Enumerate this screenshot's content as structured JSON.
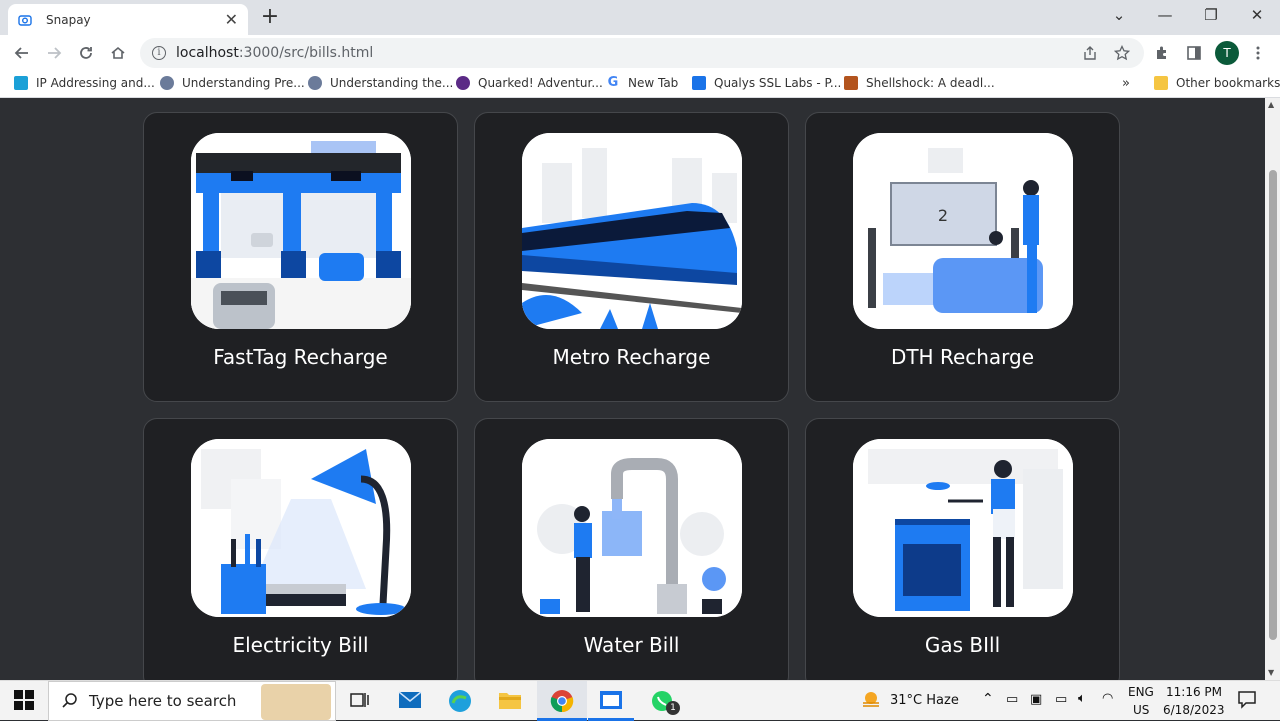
{
  "browser": {
    "tab_title": "Snapay",
    "url_host": "localhost",
    "url_path": ":3000/src/bills.html",
    "profile_initial": "T"
  },
  "bookmarks": [
    {
      "label": "IP Addressing and...",
      "icon": "cisco-icon",
      "color": "#1ba0d7"
    },
    {
      "label": "Understanding Pre...",
      "icon": "gear-favicon-icon",
      "color": "#6b7b9a"
    },
    {
      "label": "Understanding the...",
      "icon": "gear-favicon-icon",
      "color": "#6b7b9a"
    },
    {
      "label": "Quarked! Adventur...",
      "icon": "quarked-icon",
      "color": "#5b2a86"
    },
    {
      "label": "New Tab",
      "icon": "google-icon",
      "color": "#4285f4"
    },
    {
      "label": "Qualys SSL Labs - P...",
      "icon": "qualys-icon",
      "color": "#1a73e8"
    },
    {
      "label": "Shellshock: A deadl...",
      "icon": "shellshock-icon",
      "color": "#b3541e"
    }
  ],
  "other_bookmarks": "Other bookmarks",
  "cards": [
    {
      "label": "FastTag Recharge",
      "icon": "toll-plaza-illustration"
    },
    {
      "label": "Metro Recharge",
      "icon": "metro-train-illustration"
    },
    {
      "label": "DTH Recharge",
      "icon": "tv-watching-illustration"
    },
    {
      "label": "Electricity Bill",
      "icon": "desk-lamp-illustration"
    },
    {
      "label": "Water Bill",
      "icon": "water-tap-illustration"
    },
    {
      "label": "Gas BIll",
      "icon": "gas-stove-illustration"
    }
  ],
  "taskbar": {
    "search_placeholder": "Type here to search",
    "weather": "31°C  Haze",
    "lang_top": "ENG",
    "lang_bottom": "US",
    "time": "11:16 PM",
    "date": "6/18/2023",
    "whatsapp_badge": "1"
  },
  "colors": {
    "accent": "#1a73e8",
    "page_bg": "#2d2f33",
    "card_bg": "#1f2023"
  }
}
